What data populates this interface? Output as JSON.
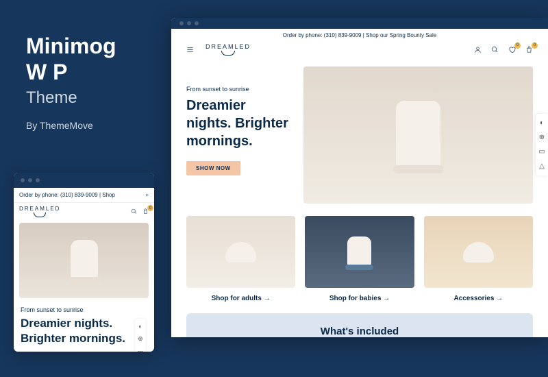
{
  "sidebar": {
    "title_line1": "Minimog",
    "title_line2": "W P",
    "theme_label": "Theme",
    "author": "By ThemeMove"
  },
  "promo": {
    "desktop": "Order by phone: (310) 839-9009 | Shop our Spring Bounty Sale",
    "mobile": "Order by phone: (310) 839-9009 | Shop"
  },
  "brand": {
    "name": "DREAMLED"
  },
  "header": {
    "wishlist_count": "0",
    "cart_count": "0"
  },
  "hero": {
    "eyebrow": "From sunset to sunrise",
    "headline": "Dreamier nights. Brighter mornings.",
    "cta": "SHOW NOW"
  },
  "categories": [
    {
      "label": "Shop for adults"
    },
    {
      "label": "Shop for babies"
    },
    {
      "label": "Accessories"
    }
  ],
  "included": {
    "title": "What's included"
  }
}
